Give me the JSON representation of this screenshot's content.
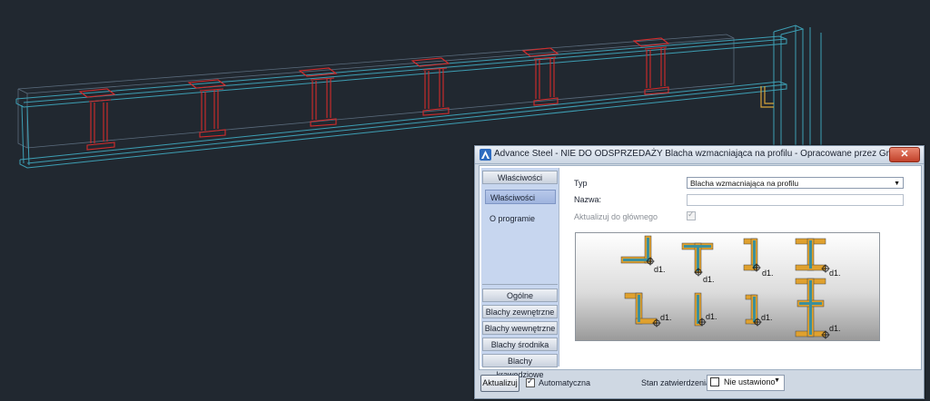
{
  "dialog": {
    "title": "Advance Steel - NIE DO ODSPRZEDAŻY   Blacha wzmacniająca na profilu - Opracowane przez Graitec",
    "close_label": "✕"
  },
  "nav": {
    "top_header": "Właściwości",
    "items": [
      "Właściwości",
      "O programie"
    ],
    "bottom_headers": [
      "Ogólne",
      "Blachy zewnętrzne",
      "Blachy wewnętrzne",
      "Blachy środnika",
      "Blachy krawędziowe"
    ]
  },
  "form": {
    "type_label": "Typ",
    "type_value": "Blacha wzmacniająca na profilu",
    "name_label": "Nazwa:",
    "name_value": "",
    "update_label": "Aktualizuj do głównego",
    "update_checked": true
  },
  "gallery": {
    "dim_label": "d1.",
    "item_count": 8
  },
  "footer": {
    "apply_label": "Aktualizuj",
    "auto_label": "Automatyczna",
    "approval_label": "Stan zatwierdzenia",
    "approval_value": "Nie ustawiono"
  },
  "colors": {
    "background": "#212830",
    "beam": "#3d9fb4",
    "plates": "#d42b2b",
    "plate_fill": "#e0a12e",
    "selected_nav": "#a9bde3"
  }
}
